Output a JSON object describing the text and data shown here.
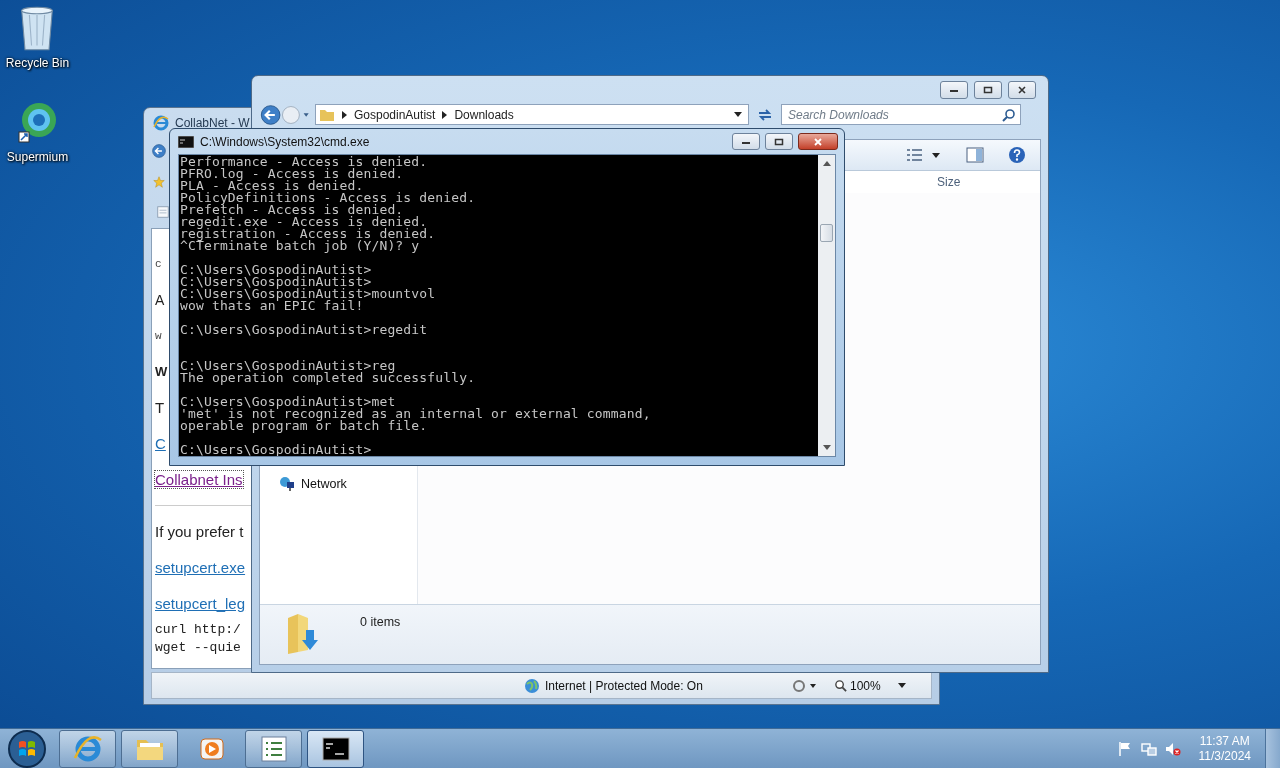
{
  "desktop_icons": [
    {
      "kind": "bin",
      "label": "Recycle Bin"
    },
    {
      "kind": "browser",
      "label": "Supermium"
    }
  ],
  "browser_window": {
    "title": "CollabNet - W",
    "content": [
      {
        "kind": "small",
        "text": "c"
      },
      {
        "kind": "large",
        "text": "A"
      },
      {
        "kind": "small",
        "text": "w"
      },
      {
        "kind": "heading",
        "text": "W"
      },
      {
        "kind": "text",
        "text": "T"
      },
      {
        "kind": "link",
        "text": "C"
      },
      {
        "kind": "visited_link",
        "text": "Collabnet Ins"
      },
      {
        "kind": "rule"
      },
      {
        "kind": "text",
        "text": "If you prefer t"
      },
      {
        "kind": "link",
        "text": "setupcert.exe"
      },
      {
        "kind": "link",
        "text": "setupcert_leg"
      },
      {
        "kind": "code",
        "text": "curl http:/"
      },
      {
        "kind": "code",
        "text": "wget --quie"
      }
    ],
    "status": "Internet | Protected Mode: On",
    "zoom": "100%"
  },
  "explorer_window": {
    "breadcrumb": [
      "GospodinAutist",
      "Downloads"
    ],
    "search": {
      "placeholder": "Search Downloads"
    },
    "column": "Size",
    "nav": [
      {
        "label": "Network"
      }
    ],
    "status": "0 items"
  },
  "console_window": {
    "title": "C:\\Windows\\System32\\cmd.exe",
    "lines": [
      {
        "kind": "text",
        "text": "Performance - Access is denied."
      },
      {
        "kind": "text",
        "text": "PFRO.log - Access is denied."
      },
      {
        "kind": "text",
        "text": "PLA - Access is denied."
      },
      {
        "kind": "text",
        "text": "PolicyDefinitions - Access is denied."
      },
      {
        "kind": "text",
        "text": "Prefetch - Access is denied."
      },
      {
        "kind": "text",
        "text": "regedit.exe - Access is denied."
      },
      {
        "kind": "text",
        "text": "registration - Access is denied."
      },
      {
        "kind": "text",
        "text": "^CTerminate batch job (Y/N)? y"
      },
      {
        "kind": "blank"
      },
      {
        "kind": "text",
        "text": "C:\\Users\\GospodinAutist>"
      },
      {
        "kind": "text",
        "text": "C:\\Users\\GospodinAutist>"
      },
      {
        "kind": "text",
        "text": "C:\\Users\\GospodinAutist>mountvol"
      },
      {
        "kind": "text",
        "text": "wow thats an EPIC fail!"
      },
      {
        "kind": "blank"
      },
      {
        "kind": "text",
        "text": "C:\\Users\\GospodinAutist>regedit"
      },
      {
        "kind": "blank"
      },
      {
        "kind": "blank"
      },
      {
        "kind": "text",
        "text": "C:\\Users\\GospodinAutist>reg"
      },
      {
        "kind": "text",
        "text": "The operation completed successfully."
      },
      {
        "kind": "blank"
      },
      {
        "kind": "text",
        "text": "C:\\Users\\GospodinAutist>met"
      },
      {
        "kind": "text",
        "text": "'met' is not recognized as an internal or external command,"
      },
      {
        "kind": "text",
        "text": "operable program or batch file."
      },
      {
        "kind": "blank"
      },
      {
        "kind": "text",
        "text": "C:\\Users\\GospodinAutist>"
      }
    ]
  },
  "taskbar": {
    "buttons": [
      {
        "kind": "browser",
        "running": true,
        "selected": false
      },
      {
        "kind": "folder",
        "running": true,
        "selected": false
      },
      {
        "kind": "media",
        "running": false,
        "selected": false
      },
      {
        "kind": "list",
        "running": true,
        "selected": false
      },
      {
        "kind": "console",
        "running": true,
        "selected": true
      }
    ],
    "time": "11:37 AM",
    "date": "11/3/2024"
  }
}
